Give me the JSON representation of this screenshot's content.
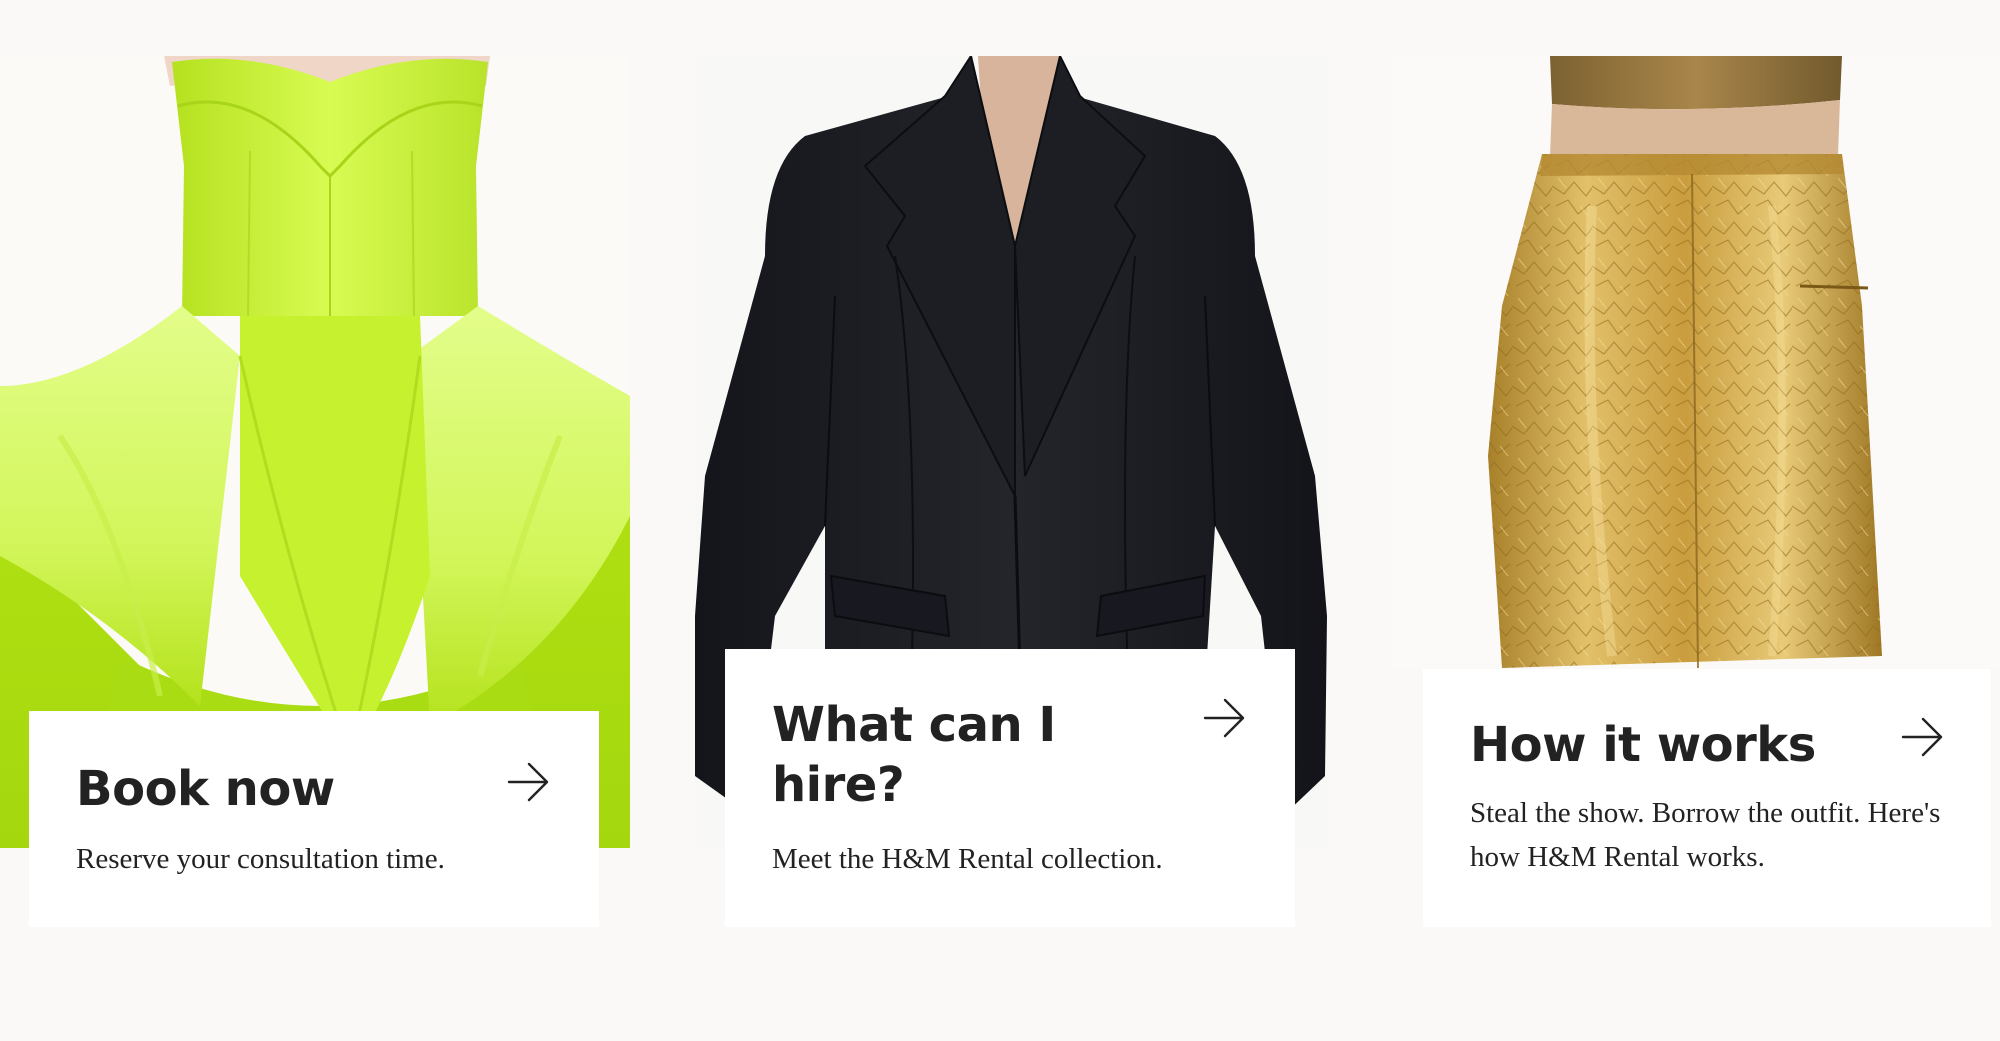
{
  "cards": [
    {
      "title": "Book now",
      "description": "Reserve your consultation time.",
      "image": "lime-green satin corset mini dress with voluminous peplum skirt",
      "arrow_icon": "arrow-right-icon"
    },
    {
      "title": "What can I hire?",
      "description": "Meet the H&M Rental collection.",
      "image": "black tailored blazer with peak lapels",
      "arrow_icon": "arrow-right-icon"
    },
    {
      "title": "How it works",
      "description": "Steal the show. Borrow the outfit. Here's how H&M Rental works.",
      "image": "gold metallic crinkle leather pencil skirt",
      "arrow_icon": "arrow-right-icon"
    }
  ],
  "colors": {
    "page_background": "#faf9f8",
    "panel_background": "#ffffff",
    "text": "#222222",
    "dress_lime": "#c9f53a",
    "blazer_black": "#1b1c21",
    "skirt_gold": "#c9a144"
  }
}
